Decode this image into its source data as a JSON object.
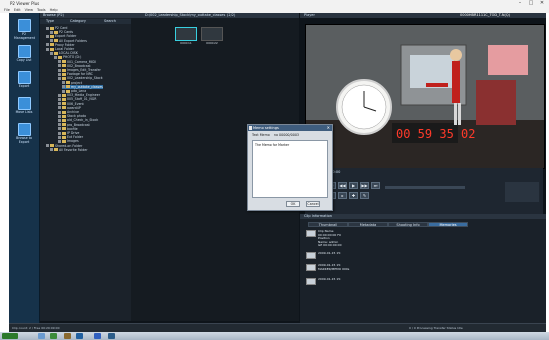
{
  "window": {
    "title": "P2 Viewer Plus",
    "menu": [
      "File",
      "Edit",
      "View",
      "Tools",
      "Help"
    ]
  },
  "sidebar": {
    "items": [
      {
        "label": "P2 Management"
      },
      {
        "label": "Copy List"
      },
      {
        "label": "Export"
      },
      {
        "label": "Move Lists"
      },
      {
        "label": "Browse to Export"
      }
    ]
  },
  "tree": {
    "header": "Browse (P2)",
    "columns": [
      "Type",
      "Category",
      "Search"
    ],
    "rows": [
      {
        "label": "P2 Card",
        "indent": 1
      },
      {
        "label": "P2 Cards",
        "indent": 2
      },
      {
        "label": "Export Folder",
        "indent": 1
      },
      {
        "label": "All Export Folders",
        "indent": 2
      },
      {
        "label": "Proxy Folder",
        "indent": 1
      },
      {
        "label": "Local Folder",
        "indent": 1
      },
      {
        "label": "LOCAL DISK",
        "indent": 2
      },
      {
        "label": "PHOTO (D:)",
        "indent": 3
      },
      {
        "label": "001_Camera_MIDI",
        "indent": 4
      },
      {
        "label": "002_Broadcast",
        "indent": 4
      },
      {
        "label": "Images_Edit_Transfer",
        "indent": 4
      },
      {
        "label": "Footage for NRC",
        "indent": 4
      },
      {
        "label": "002_Leadership_Stock",
        "indent": 4
      },
      {
        "label": "project",
        "indent": 5
      },
      {
        "label": "my_outtake_classes",
        "indent": 5,
        "selected": true
      },
      {
        "label": "pdo_Lena",
        "indent": 5
      },
      {
        "label": "003_Media_Engineer",
        "indent": 4
      },
      {
        "label": "005_Staff_01_NGR",
        "indent": 4
      },
      {
        "label": "006_Event",
        "indent": 4
      },
      {
        "label": "award4P",
        "indent": 4
      },
      {
        "label": "Archive",
        "indent": 4
      },
      {
        "label": "Stock photo",
        "indent": 4
      },
      {
        "label": "old_Check_In_Stock",
        "indent": 4
      },
      {
        "label": "pro_Broadcast",
        "indent": 4
      },
      {
        "label": "boxfile",
        "indent": 4
      },
      {
        "label": "IP Drive",
        "indent": 4
      },
      {
        "label": "Ext Folder",
        "indent": 4
      },
      {
        "label": "Images",
        "indent": 4
      },
      {
        "label": "Shared-on Folder",
        "indent": 1
      },
      {
        "label": "All Favorite Folder",
        "indent": 2
      }
    ]
  },
  "thumbnails": {
    "header_path": "D:\\002_Leadership_Stock\\my_outtake_classes",
    "count_label": "(2/2)",
    "items": [
      {
        "label": "000C11",
        "selected": true
      },
      {
        "label": "000C22",
        "selected": false
      }
    ]
  },
  "viewer": {
    "header": "Player",
    "clip_id": "0000HBR1111C_TOD_T-N(Q)",
    "timecode": "00 59 35 02",
    "duration_label": "Dur",
    "duration_value": "00:00:00:00"
  },
  "dialog": {
    "title": "Memo settings",
    "field_label": "Text Memo",
    "field_hint": "no 00000/0003",
    "body_text": "The Memo for Marker",
    "ok_label": "OK",
    "cancel_label": "Cancel"
  },
  "clipinfo": {
    "header": "Clip Information",
    "tabs": [
      "Thumbnail",
      "Metadata",
      "Shooting Info",
      "Memories"
    ],
    "active_tab": 3,
    "entries": [
      {
        "line1": "Clip Name",
        "line2": "00:00:00:00 F0",
        "line3": "Position",
        "line4": "Name: admin",
        "line5": "GE 00:00:00:00"
      },
      {
        "line1": "2009-01-15 15:"
      },
      {
        "line1": "2009-01-15 15:",
        "line2": "MARKER/MEMO 000s"
      },
      {
        "line1": "2009-01-15 15:"
      }
    ]
  },
  "statusbar": {
    "left": "Clip count: 2 / Free 00:29:09:00",
    "right": "0 / 0 Processing  Transfer  Status  Idle"
  }
}
